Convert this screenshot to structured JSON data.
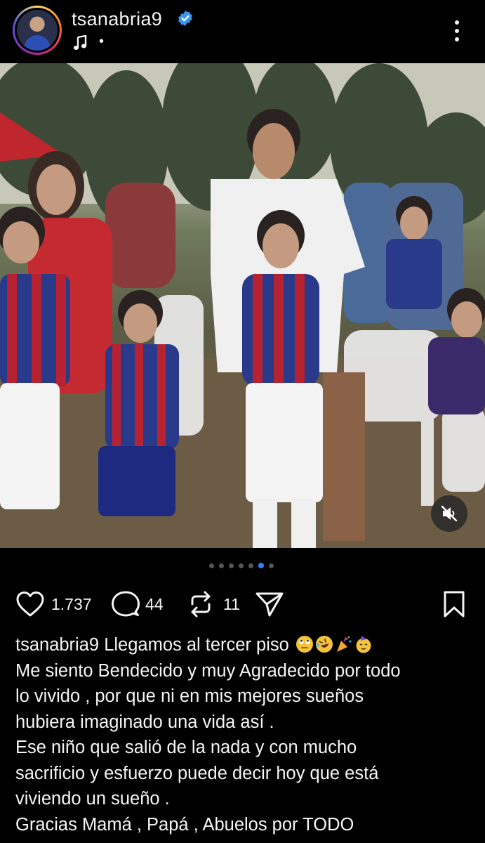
{
  "post_header": {
    "username": "tsanabria9",
    "verified": true,
    "music_icon": "music-note-icon",
    "dot": "•"
  },
  "media": {
    "carousel_total": 8,
    "carousel_active_index": 6,
    "sound": "muted"
  },
  "actions": {
    "likes": "1.737",
    "comments": "44",
    "reposts": "11",
    "icons": [
      "heart-icon",
      "comment-icon",
      "repost-icon",
      "share-icon",
      "bookmark-icon"
    ]
  },
  "caption": {
    "username": "tsanabria9",
    "first_line_text": "Llegamos al tercer piso",
    "lines": [
      "Me siento Bendecido y muy Agradecido por todo",
      "lo vivido , por que ni en mis mejores sueños",
      "hubiera imaginado una vida así .",
      "Ese niño que salió de la nada y con mucho",
      "sacrificio y esfuerzo puede decir hoy que está",
      "viviendo un sueño .",
      "Gracias Mamá , Papá , Abuelos por TODO"
    ]
  },
  "colors": {
    "background": "#000000",
    "text": "#f5f5f5",
    "verified_blue": "#3897f0",
    "pager_active": "#3d7bff",
    "pager_inactive": "#555555"
  }
}
